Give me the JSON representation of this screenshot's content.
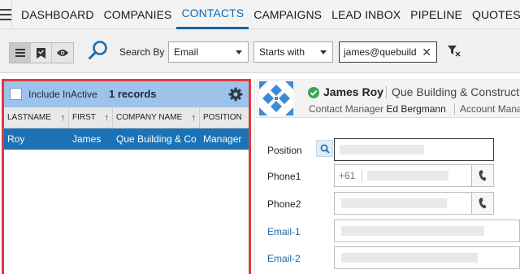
{
  "nav": {
    "items": [
      {
        "label": "DASHBOARD",
        "active": false
      },
      {
        "label": "COMPANIES",
        "active": false
      },
      {
        "label": "CONTACTS",
        "active": true
      },
      {
        "label": "CAMPAIGNS",
        "active": false
      },
      {
        "label": "LEAD INBOX",
        "active": false
      },
      {
        "label": "PIPELINE",
        "active": false
      },
      {
        "label": "QUOTES",
        "active": false
      }
    ]
  },
  "toolbar": {
    "search_by_label": "Search By",
    "field_select": "Email",
    "operator_select": "Starts with",
    "search_value": "james@quebuild",
    "clear_label": "✕"
  },
  "list": {
    "include_inactive_label": "Include InActive",
    "records_label": "1 records",
    "columns": [
      "LASTNAME",
      "FIRST",
      "COMPANY NAME",
      "POSITION"
    ],
    "rows": [
      {
        "lastname": "Roy",
        "first": "James",
        "company": "Que Building & Co",
        "position": "Manager"
      }
    ]
  },
  "contact": {
    "name": "James Roy",
    "company": "Que Building & Construct",
    "contact_manager_label": "Contact Manager",
    "contact_manager": "Ed Bergmann",
    "account_manager_label": "Account Mana"
  },
  "fields": {
    "position_label": "Position",
    "phone1_label": "Phone1",
    "phone1_code": "+61",
    "phone2_label": "Phone2",
    "email1_label": "Email-1",
    "email2_label": "Email-2"
  },
  "colors": {
    "accent": "#1565a8",
    "list_header": "#9ec3ea",
    "selected_row": "#1c72b4",
    "highlight_border": "#e0393e",
    "status_ok": "#3aa757"
  }
}
